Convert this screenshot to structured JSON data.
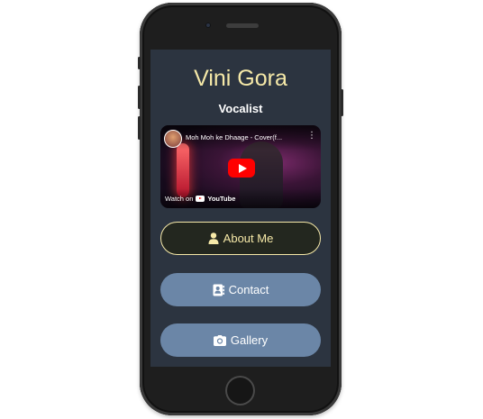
{
  "profile": {
    "name": "Vini Gora",
    "role": "Vocalist"
  },
  "video": {
    "title": "Moh Moh ke Dhaage - Cover(f...",
    "menu_icon": "more-vert-icon",
    "watch_on": "Watch on",
    "platform": "YouTube",
    "play_color": "#ff0000"
  },
  "buttons": [
    {
      "label": "About Me",
      "icon": "user-icon"
    },
    {
      "label": "Contact",
      "icon": "contact-card-icon"
    },
    {
      "label": "Gallery",
      "icon": "camera-icon"
    }
  ],
  "colors": {
    "accent": "#f6e9a8",
    "screen_bg": "#2c3440",
    "button_bg": "#6b86a7",
    "about_bg": "#23271f"
  }
}
